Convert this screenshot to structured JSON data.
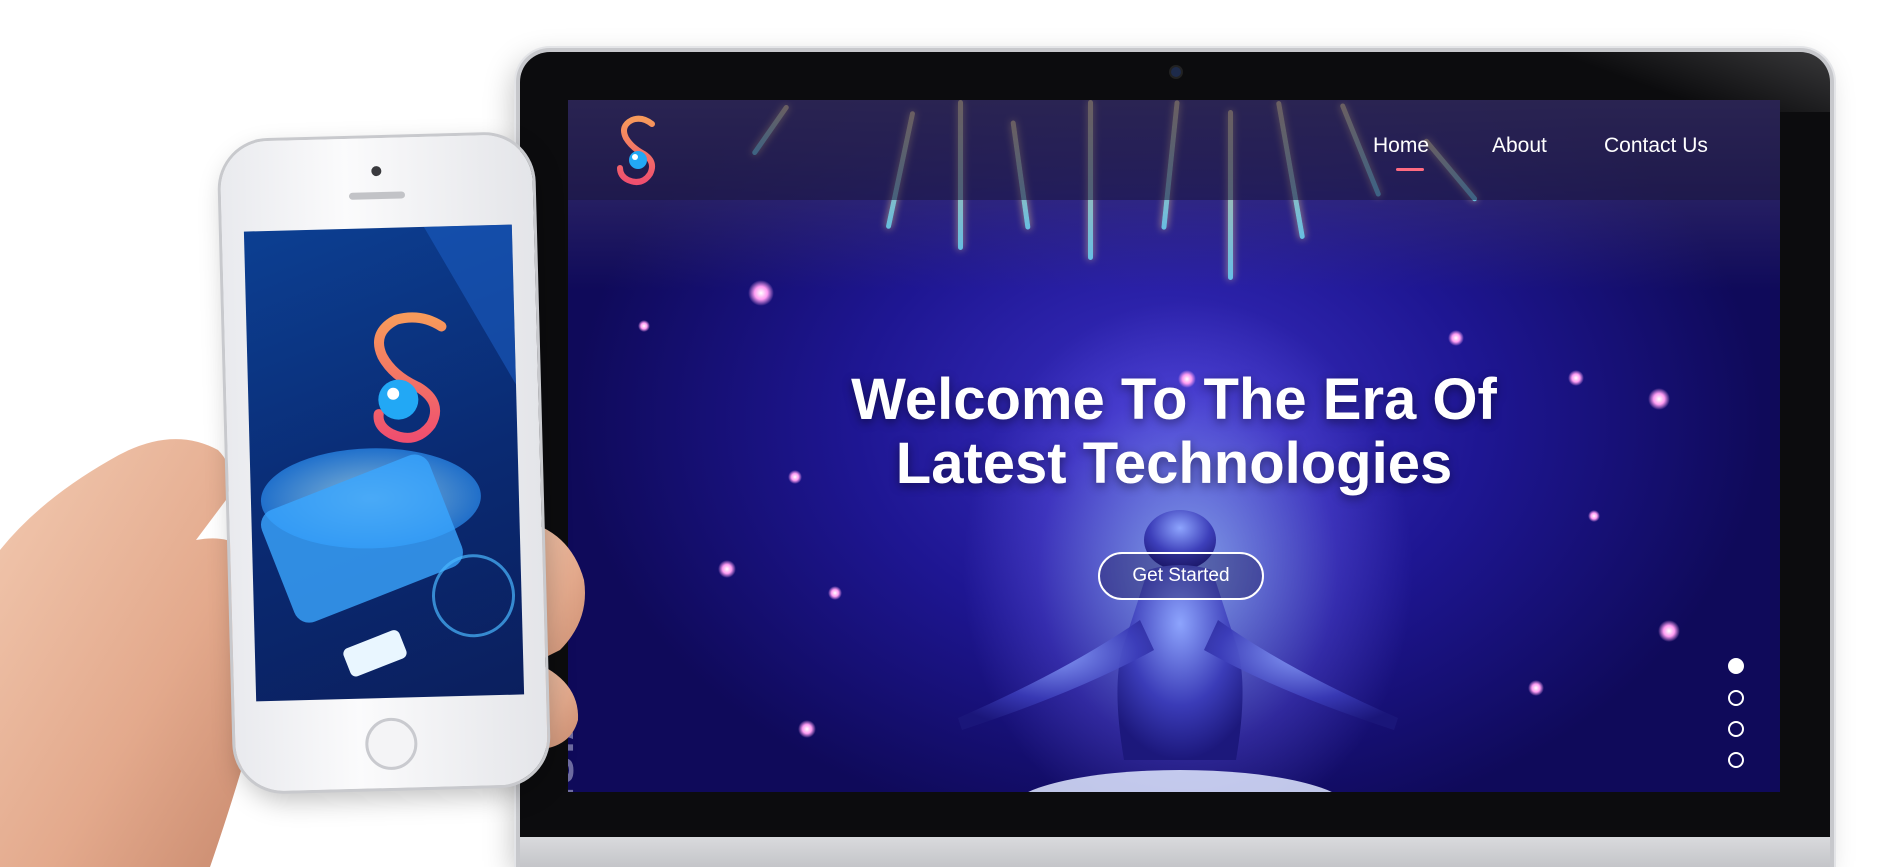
{
  "site": {
    "nav": {
      "home": "Home",
      "about": "About",
      "contact": "Contact Us"
    },
    "hero": {
      "title_line1": "Welcome To The Era Of",
      "title_line2": "Latest Technologies",
      "cta": "Get Started"
    },
    "side_text": "VISION",
    "slider": {
      "count": 4,
      "active_index": 0
    }
  },
  "colors": {
    "accent": "#ff6b81",
    "hero_bg": "#1e1692",
    "logo_pink": "#ef4f6f",
    "logo_orange": "#f79a5b",
    "logo_blue": "#22a8f5"
  },
  "icons": {
    "site_logo": "s-logo-icon",
    "monitor_logo": "apple-logo-icon"
  }
}
